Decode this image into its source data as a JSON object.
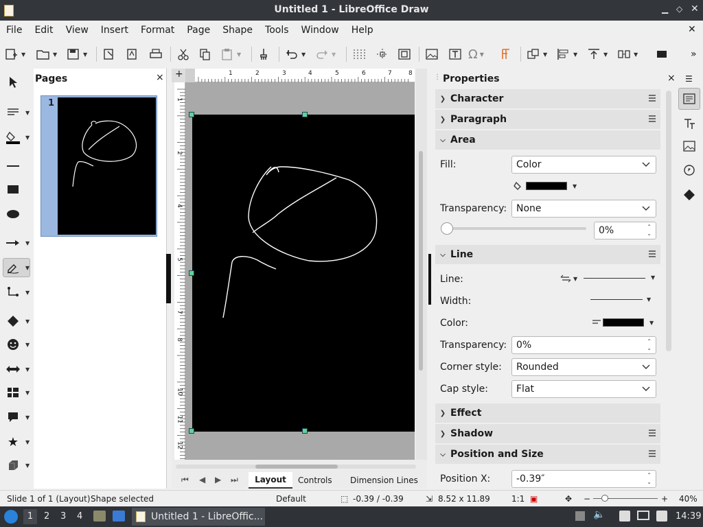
{
  "window": {
    "title": "Untitled 1 - LibreOffice Draw"
  },
  "menu": [
    "File",
    "Edit",
    "View",
    "Insert",
    "Format",
    "Page",
    "Shape",
    "Tools",
    "Window",
    "Help"
  ],
  "pages_panel": {
    "title": "Pages",
    "page_number": "1"
  },
  "ruler": {
    "h_ticks": [
      "1",
      "2",
      "3",
      "4",
      "5",
      "6",
      "7",
      "8"
    ],
    "v_ticks": [
      "1",
      "2",
      "3",
      "4",
      "5",
      "6",
      "7",
      "8",
      "9",
      "10",
      "11",
      "12"
    ]
  },
  "tabs": [
    "Layout",
    "Controls",
    "Dimension Lines"
  ],
  "properties": {
    "title": "Properties",
    "sections": {
      "character": "Character",
      "paragraph": "Paragraph",
      "area": "Area",
      "line": "Line",
      "effect": "Effect",
      "shadow": "Shadow",
      "position": "Position and Size"
    },
    "area": {
      "fill_label": "Fill:",
      "fill_value": "Color",
      "fill_color": "#000000",
      "transparency_label": "Transparency:",
      "transparency_value": "None",
      "transparency_pct": "0%"
    },
    "line": {
      "line_label": "Line:",
      "width_label": "Width:",
      "color_label": "Color:",
      "color_value": "#000000",
      "transparency_label": "Transparency:",
      "transparency_value": "0%",
      "corner_label": "Corner style:",
      "corner_value": "Rounded",
      "cap_label": "Cap style:",
      "cap_value": "Flat"
    },
    "position": {
      "x_label": "Position X:",
      "x_value": "-0.39″"
    }
  },
  "status": {
    "slide": "Slide 1 of 1 (Layout)",
    "selection": "Shape selected",
    "master": "Default",
    "position": "-0.39 / -0.39",
    "size": "8.52 x 11.89",
    "scale": "1:1",
    "zoom": "40%"
  },
  "taskbar": {
    "workspaces": [
      "1",
      "2",
      "3",
      "4"
    ],
    "app_label": "Untitled 1 - LibreOffic...",
    "clock": "14:39"
  }
}
